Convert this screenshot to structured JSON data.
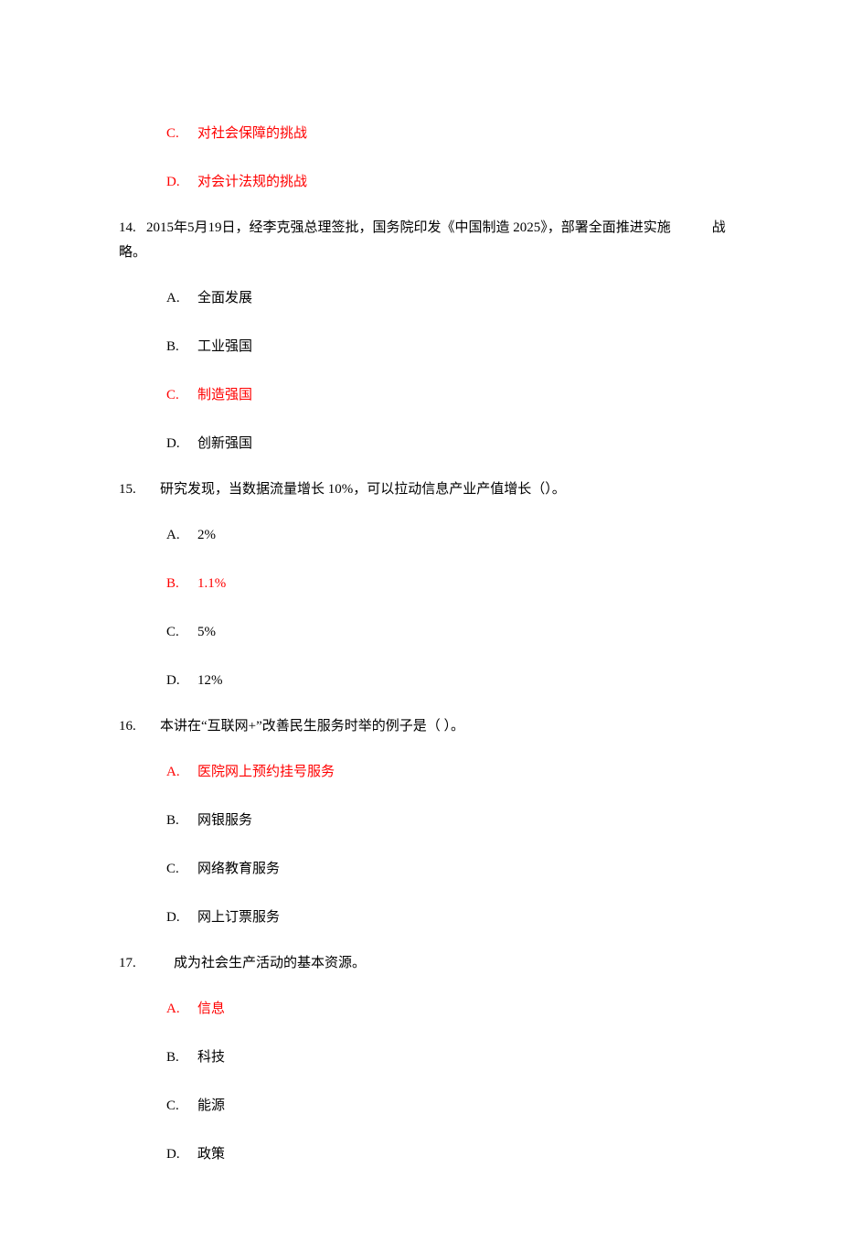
{
  "leading_options": [
    {
      "letter": "C.",
      "text": "对社会保障的挑战",
      "red": true
    },
    {
      "letter": "D.",
      "text": "对会计法规的挑战",
      "red": true
    }
  ],
  "questions": [
    {
      "num": "14.",
      "stem": "2015年5月19日，经李克强总理签批，国务院印发《中国制造 2025》，部署全面推进实施　　　战略。",
      "options": [
        {
          "letter": "A.",
          "text": "全面发展",
          "red": false
        },
        {
          "letter": "B.",
          "text": "工业强国",
          "red": false
        },
        {
          "letter": "C.",
          "text": "制造强国",
          "red": true
        },
        {
          "letter": "D.",
          "text": "创新强国",
          "red": false
        }
      ]
    },
    {
      "num": "15.",
      "stem": "　研究发现，当数据流量增长 10%，可以拉动信息产业产值增长（）。",
      "options": [
        {
          "letter": "A.",
          "text": "2%",
          "red": false
        },
        {
          "letter": "B.",
          "text": "1.1%",
          "red": true
        },
        {
          "letter": "C.",
          "text": "5%",
          "red": false
        },
        {
          "letter": "D.",
          "text": "12%",
          "red": false
        }
      ]
    },
    {
      "num": "16.",
      "stem": "　本讲在“互联网+”改善民生服务时举的例子是（ ）。",
      "options": [
        {
          "letter": "A.",
          "text": "医院网上预约挂号服务",
          "red": true
        },
        {
          "letter": "B.",
          "text": "网银服务",
          "red": false
        },
        {
          "letter": "C.",
          "text": "网络教育服务",
          "red": false
        },
        {
          "letter": "D.",
          "text": "网上订票服务",
          "red": false
        }
      ]
    },
    {
      "num": "17.",
      "stem": "　　成为社会生产活动的基本资源。",
      "options": [
        {
          "letter": "A.",
          "text": "信息",
          "red": true
        },
        {
          "letter": "B.",
          "text": "科技",
          "red": false
        },
        {
          "letter": "C.",
          "text": "能源",
          "red": false
        },
        {
          "letter": "D.",
          "text": "政策",
          "red": false
        }
      ]
    }
  ]
}
